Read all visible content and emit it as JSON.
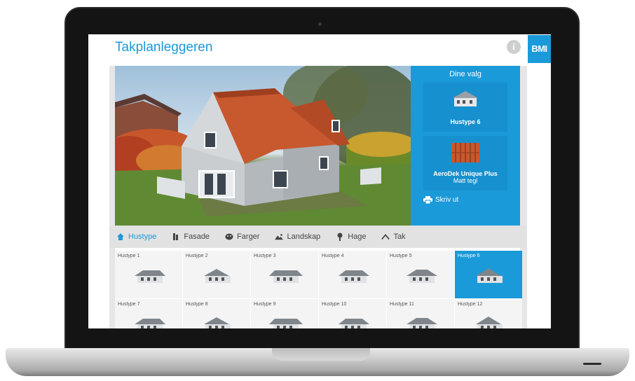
{
  "app": {
    "title": "Takplanleggeren",
    "logo_text": "BMI",
    "info_icon": "info-icon",
    "brand_color": "#1a9ad9"
  },
  "choices": {
    "heading": "Dine valg",
    "house": {
      "name": "Hustype 6"
    },
    "roof": {
      "name": "AeroDek Unique Plus",
      "subtitle": "Matt tegl"
    },
    "print_label": "Skriv ut"
  },
  "tabs": [
    {
      "label": "Hustype",
      "icon": "house-icon",
      "active": true
    },
    {
      "label": "Fasade",
      "icon": "facade-icon",
      "active": false
    },
    {
      "label": "Farger",
      "icon": "palette-icon",
      "active": false
    },
    {
      "label": "Landskap",
      "icon": "landscape-icon",
      "active": false
    },
    {
      "label": "Hage",
      "icon": "tree-icon",
      "active": false
    },
    {
      "label": "Tak",
      "icon": "roof-icon",
      "active": false
    }
  ],
  "house_types": [
    {
      "label": "Hustype 1",
      "selected": false
    },
    {
      "label": "Hustype 2",
      "selected": false
    },
    {
      "label": "Hustype 3",
      "selected": false
    },
    {
      "label": "Hustype 4",
      "selected": false
    },
    {
      "label": "Hustype 5",
      "selected": false
    },
    {
      "label": "Hustype 6",
      "selected": true
    },
    {
      "label": "Hustype 7",
      "selected": false
    },
    {
      "label": "Hustype 8",
      "selected": false
    },
    {
      "label": "Hustype 9",
      "selected": false
    },
    {
      "label": "Hustype 10",
      "selected": false
    },
    {
      "label": "Hustype 11",
      "selected": false
    },
    {
      "label": "Hustype 12",
      "selected": false
    }
  ]
}
